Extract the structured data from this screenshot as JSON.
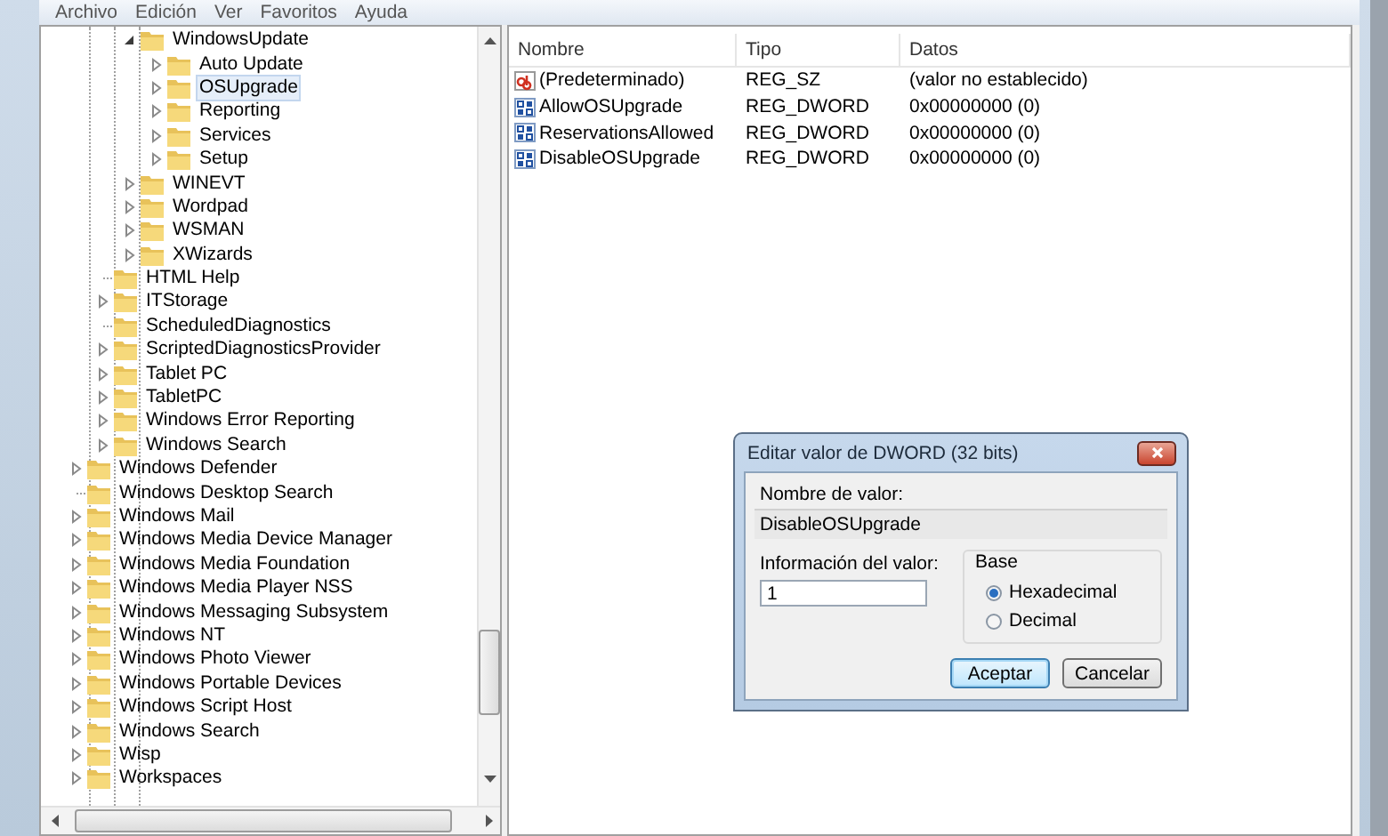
{
  "menu": [
    {
      "label": "Archivo"
    },
    {
      "label": "Edición"
    },
    {
      "label": "Ver"
    },
    {
      "label": "Favoritos"
    },
    {
      "label": "Ayuda"
    }
  ],
  "tree": [
    {
      "children": [
        {
          "children": [
            {
              "label": "WindowsUpdate",
              "has_children": true,
              "expanded": true,
              "selected": false,
              "children": [
                {
                  "label": "Auto Update",
                  "has_children": true,
                  "expanded": false,
                  "selected": false
                },
                {
                  "label": "OSUpgrade",
                  "has_children": true,
                  "expanded": false,
                  "selected": true
                },
                {
                  "label": "Reporting",
                  "has_children": true,
                  "expanded": false,
                  "selected": false
                },
                {
                  "label": "Services",
                  "has_children": true,
                  "expanded": false,
                  "selected": false
                },
                {
                  "label": "Setup",
                  "has_children": true,
                  "expanded": false,
                  "selected": false
                }
              ]
            },
            {
              "label": "WINEVT",
              "has_children": true,
              "expanded": false,
              "selected": false
            },
            {
              "label": "Wordpad",
              "has_children": true,
              "expanded": false,
              "selected": false
            },
            {
              "label": "WSMAN",
              "has_children": true,
              "expanded": false,
              "selected": false
            },
            {
              "label": "XWizards",
              "has_children": true,
              "expanded": false,
              "selected": false
            }
          ]
        },
        {
          "label": "HTML Help",
          "has_children": false,
          "selected": false
        },
        {
          "label": "ITStorage",
          "has_children": true,
          "expanded": false,
          "selected": false
        },
        {
          "label": "ScheduledDiagnostics",
          "has_children": false,
          "selected": false
        },
        {
          "label": "ScriptedDiagnosticsProvider",
          "has_children": true,
          "expanded": false,
          "selected": false
        },
        {
          "label": "Tablet PC",
          "has_children": true,
          "expanded": false,
          "selected": false
        },
        {
          "label": "TabletPC",
          "has_children": true,
          "expanded": false,
          "selected": false
        },
        {
          "label": "Windows Error Reporting",
          "has_children": true,
          "expanded": false,
          "selected": false
        },
        {
          "label": "Windows Search",
          "has_children": true,
          "expanded": false,
          "selected": false
        }
      ]
    },
    {
      "label": "Windows Defender",
      "has_children": true,
      "expanded": false,
      "selected": false
    },
    {
      "label": "Windows Desktop Search",
      "has_children": false,
      "selected": false
    },
    {
      "label": "Windows Mail",
      "has_children": true,
      "expanded": false,
      "selected": false
    },
    {
      "label": "Windows Media Device Manager",
      "has_children": true,
      "expanded": false,
      "selected": false
    },
    {
      "label": "Windows Media Foundation",
      "has_children": true,
      "expanded": false,
      "selected": false
    },
    {
      "label": "Windows Media Player NSS",
      "has_children": true,
      "expanded": false,
      "selected": false
    },
    {
      "label": "Windows Messaging Subsystem",
      "has_children": true,
      "expanded": false,
      "selected": false
    },
    {
      "label": "Windows NT",
      "has_children": true,
      "expanded": false,
      "selected": false
    },
    {
      "label": "Windows Photo Viewer",
      "has_children": true,
      "expanded": false,
      "selected": false
    },
    {
      "label": "Windows Portable Devices",
      "has_children": true,
      "expanded": false,
      "selected": false
    },
    {
      "label": "Windows Script Host",
      "has_children": true,
      "expanded": false,
      "selected": false
    },
    {
      "label": "Windows Search",
      "has_children": true,
      "expanded": false,
      "selected": false
    },
    {
      "label": "Wisp",
      "has_children": true,
      "expanded": false,
      "selected": false
    },
    {
      "label": "Workspaces",
      "has_children": true,
      "expanded": false,
      "selected": false
    }
  ],
  "values": {
    "columns": [
      "Nombre",
      "Tipo",
      "Datos"
    ],
    "rows": [
      {
        "kind": "string",
        "name": "(Predeterminado)",
        "type": "REG_SZ",
        "data": "(valor no establecido)"
      },
      {
        "kind": "dword",
        "name": "AllowOSUpgrade",
        "type": "REG_DWORD",
        "data": "0x00000000 (0)"
      },
      {
        "kind": "dword",
        "name": "ReservationsAllowed",
        "type": "REG_DWORD",
        "data": "0x00000000 (0)"
      },
      {
        "kind": "dword",
        "name": "DisableOSUpgrade",
        "type": "REG_DWORD",
        "data": "0x00000000 (0)"
      }
    ]
  },
  "dialog": {
    "title": "Editar valor de DWORD (32 bits)",
    "name_label": "Nombre de valor:",
    "name_value": "DisableOSUpgrade",
    "data_label": "Información del valor:",
    "data_value": "1",
    "base_label": "Base",
    "base_options": [
      {
        "label": "Hexadecimal",
        "selected": true
      },
      {
        "label": "Decimal",
        "selected": false
      }
    ],
    "buttons": [
      {
        "label": "Aceptar",
        "default": true
      },
      {
        "label": "Cancelar",
        "default": false
      }
    ]
  }
}
